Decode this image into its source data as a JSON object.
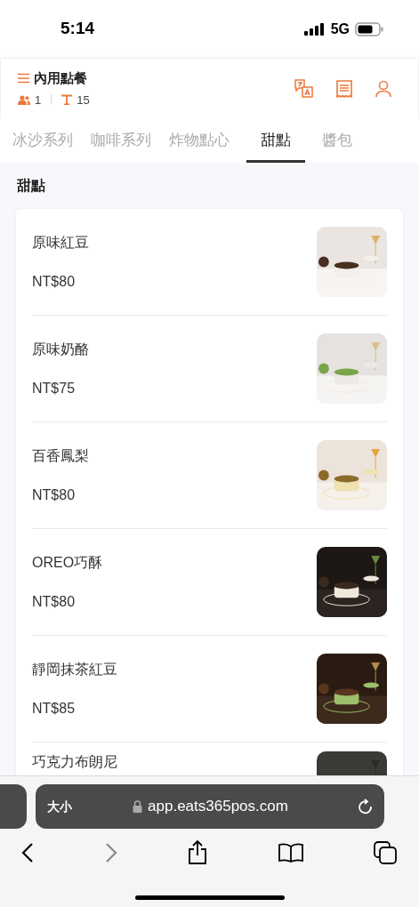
{
  "status_bar": {
    "time": "5:14",
    "network": "5G"
  },
  "header": {
    "title": "內用點餐",
    "guests": "1",
    "table": "15"
  },
  "tabs": [
    {
      "label": "冰沙系列",
      "selected": false
    },
    {
      "label": "咖啡系列",
      "selected": false
    },
    {
      "label": "炸物點心",
      "selected": false
    },
    {
      "label": "甜點",
      "selected": true
    },
    {
      "label": "醬包",
      "selected": false
    }
  ],
  "section": {
    "title": "甜點"
  },
  "items": [
    {
      "name": "原味紅豆",
      "price": "NT$80"
    },
    {
      "name": "原味奶酪",
      "price": "NT$75"
    },
    {
      "name": "百香鳳梨",
      "price": "NT$80"
    },
    {
      "name": "OREO巧酥",
      "price": "NT$80"
    },
    {
      "name": "靜岡抹茶紅豆",
      "price": "NT$85"
    },
    {
      "name": "巧克力布朗尼"
    }
  ],
  "browser": {
    "text_size": "大小",
    "url": "app.eats365pos.com"
  }
}
